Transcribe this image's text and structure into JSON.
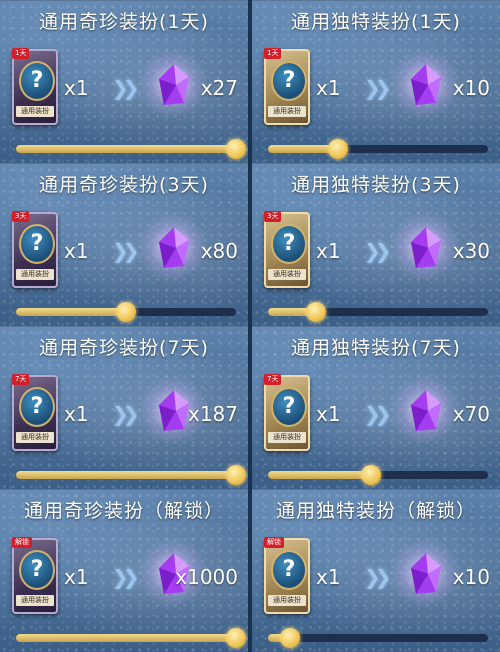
{
  "panels": [
    {
      "title": "通用奇珍装扮(1天)",
      "card_type": "rare",
      "card_tag": "1天",
      "card_name": "通用装扮",
      "from_qty": "x1",
      "to_qty": "x27",
      "slider_level": 1.0
    },
    {
      "title": "通用独特装扮(1天)",
      "card_type": "unique",
      "card_tag": "1天",
      "card_name": "通用装扮",
      "from_qty": "x1",
      "to_qty": "x10",
      "slider_level": 0.32
    },
    {
      "title": "通用奇珍装扮(3天)",
      "card_type": "rare",
      "card_tag": "3天",
      "card_name": "通用装扮",
      "from_qty": "x1",
      "to_qty": "x80",
      "slider_level": 0.5
    },
    {
      "title": "通用独特装扮(3天)",
      "card_type": "unique",
      "card_tag": "3天",
      "card_name": "通用装扮",
      "from_qty": "x1",
      "to_qty": "x30",
      "slider_level": 0.22
    },
    {
      "title": "通用奇珍装扮(7天)",
      "card_type": "rare",
      "card_tag": "7天",
      "card_name": "通用装扮",
      "from_qty": "x1",
      "to_qty": "x187",
      "slider_level": 1.0
    },
    {
      "title": "通用独特装扮(7天)",
      "card_type": "unique",
      "card_tag": "7天",
      "card_name": "通用装扮",
      "from_qty": "x1",
      "to_qty": "x70",
      "slider_level": 0.47
    },
    {
      "title": "通用奇珍装扮（解锁）",
      "card_type": "rare",
      "card_tag": "解锁",
      "card_name": "通用装扮",
      "from_qty": "x1",
      "to_qty": "x1000",
      "slider_level": 1.0
    },
    {
      "title": "通用独特装扮（解锁）",
      "card_type": "unique",
      "card_tag": "解锁",
      "card_name": "通用装扮",
      "from_qty": "x1",
      "to_qty": "x10",
      "slider_level": 0.1
    }
  ],
  "icons": {
    "card": "mystery-outfit-card-icon",
    "crystal": "purple-crystal-icon",
    "arrows": "double-chevron-right-icon"
  },
  "colors": {
    "crystal": "#b347ff",
    "slider_fill": "#e8c96a",
    "slider_track": "#1d2f4c"
  }
}
